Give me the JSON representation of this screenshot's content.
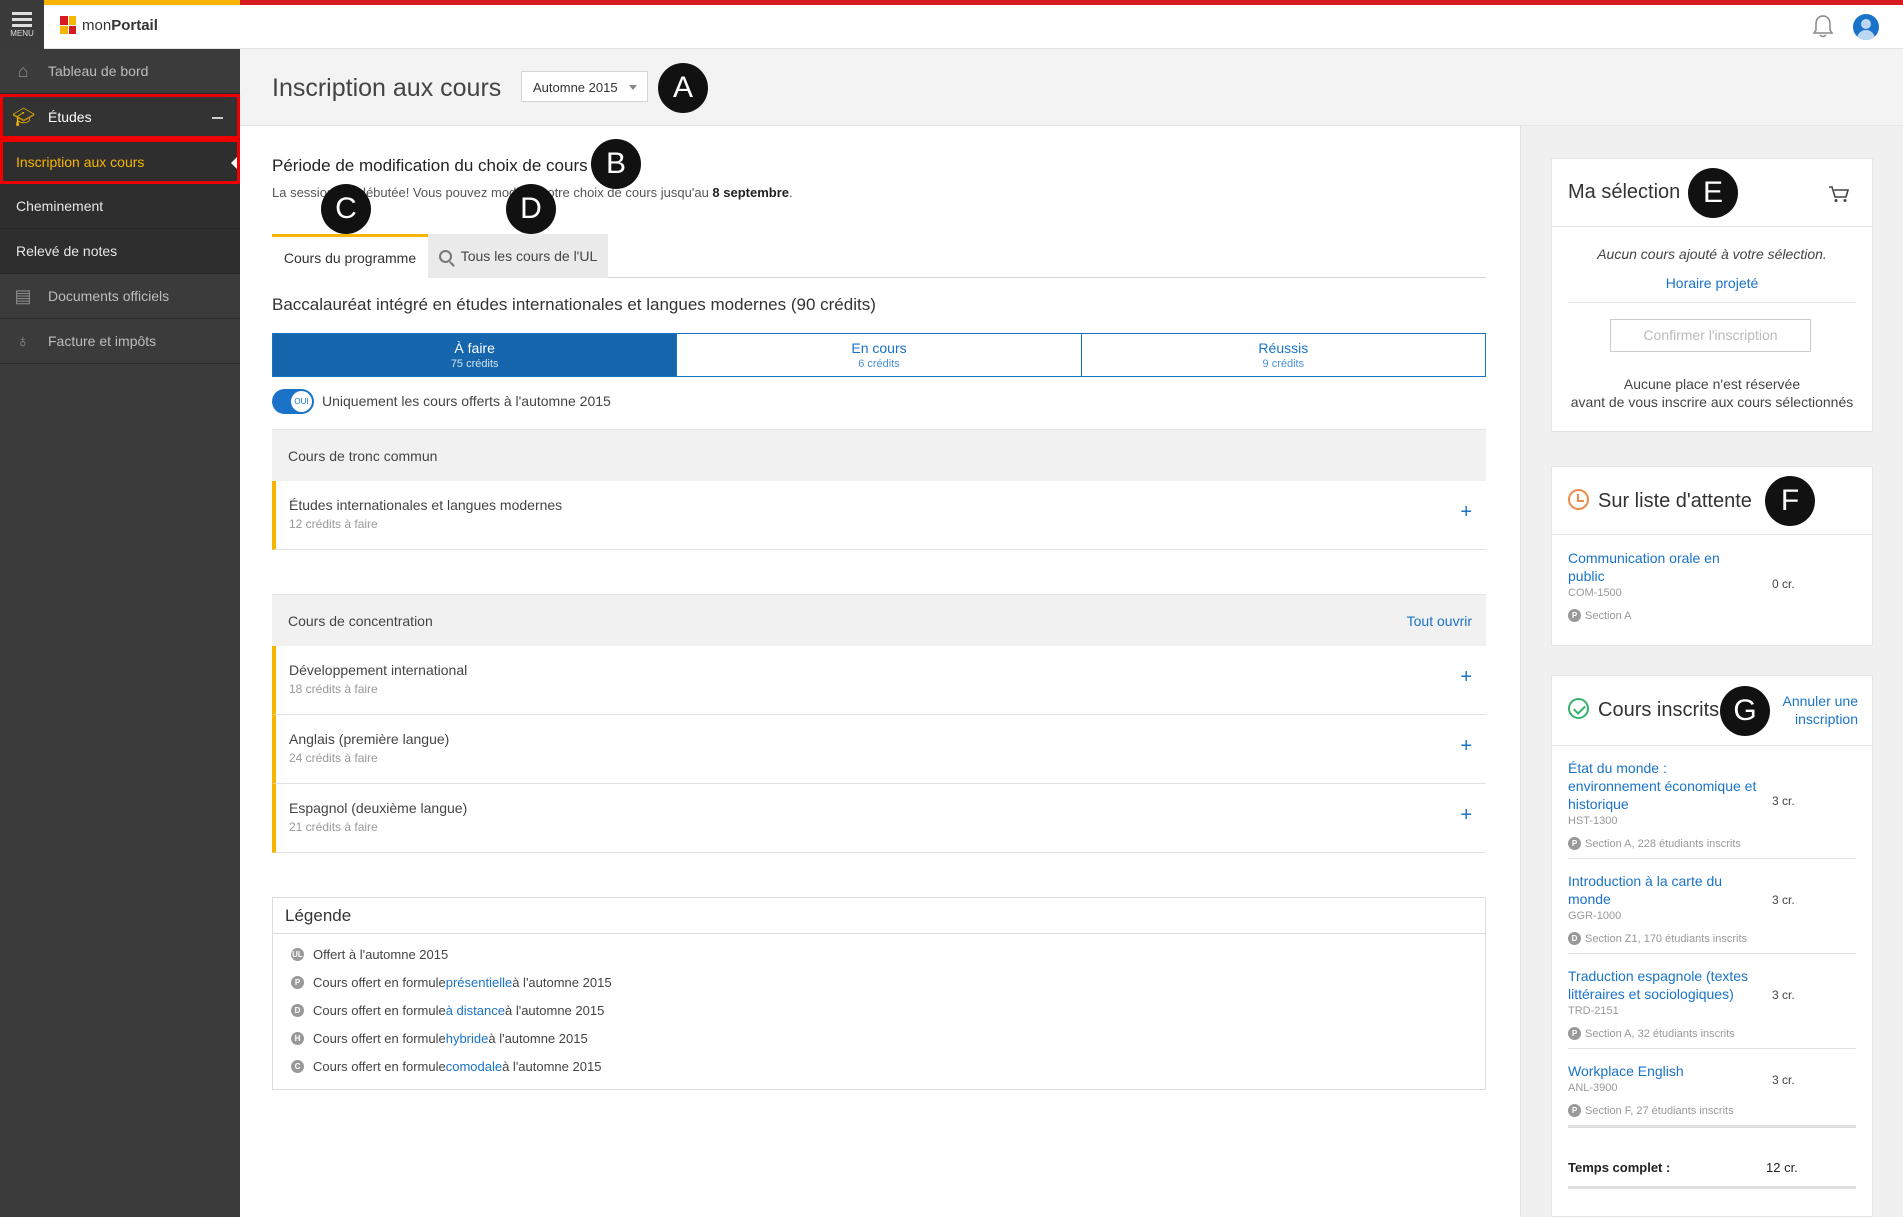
{
  "app": {
    "logo_prefix": "mon",
    "logo_bold": "Portail",
    "menu_label": "MENU"
  },
  "sidebar": {
    "items": [
      {
        "label": "Tableau de bord"
      },
      {
        "label": "Études"
      },
      {
        "label": "Documents officiels"
      },
      {
        "label": "Facture et impôts"
      }
    ],
    "subitems": [
      {
        "label": "Inscription aux cours"
      },
      {
        "label": "Cheminement"
      },
      {
        "label": "Relevé de notes"
      }
    ]
  },
  "header": {
    "title": "Inscription aux cours",
    "semester": "Automne 2015"
  },
  "markers": [
    "A",
    "B",
    "C",
    "D",
    "E",
    "F",
    "G"
  ],
  "period": {
    "title": "Période de modification du choix de cours",
    "text": "La session est débutée! Vous pouvez modifier votre choix de cours jusqu'au ",
    "date": "8 septembre",
    "dot": "."
  },
  "tabs": [
    {
      "label": "Cours du programme"
    },
    {
      "label": "Tous les cours de l'UL"
    }
  ],
  "program": {
    "title": "Baccalauréat intégré en études internationales et langues modernes (90 crédits)"
  },
  "segments": [
    {
      "label": "À faire",
      "credits": "75 crédits"
    },
    {
      "label": "En cours",
      "credits": "6 crédits"
    },
    {
      "label": "Réussis",
      "credits": "9 crédits"
    }
  ],
  "toggle": {
    "state": "OUI",
    "label": "Uniquement les cours offerts à l'automne 2015"
  },
  "groups": [
    {
      "title": "Cours de tronc commun",
      "courses": [
        {
          "name": "Études internationales et langues modernes",
          "credits": "12 crédits à faire"
        }
      ]
    },
    {
      "title": "Cours de concentration",
      "open_all": "Tout ouvrir",
      "courses": [
        {
          "name": "Développement international",
          "credits": "18 crédits à faire"
        },
        {
          "name": "Anglais (première langue)",
          "credits": "24 crédits à faire"
        },
        {
          "name": "Espagnol (deuxième langue)",
          "credits": "21 crédits à faire"
        }
      ]
    }
  ],
  "legend": {
    "title": "Légende",
    "items": [
      {
        "badge": "UL",
        "pre": "Offert à l'automne 2015",
        "link": "",
        "post": ""
      },
      {
        "badge": "P",
        "pre": "Cours offert en formule ",
        "link": "présentielle",
        "post": " à l'automne 2015"
      },
      {
        "badge": "D",
        "pre": "Cours offert en formule ",
        "link": "à distance",
        "post": " à l'automne 2015"
      },
      {
        "badge": "H",
        "pre": "Cours offert en formule ",
        "link": "hybride",
        "post": " à l'automne 2015"
      },
      {
        "badge": "C",
        "pre": "Cours offert en formule ",
        "link": "comodale",
        "post": " à l'automne 2015"
      }
    ]
  },
  "selection": {
    "title": "Ma sélection",
    "empty": "Aucun cours ajouté à votre sélection.",
    "schedule_link": "Horaire projeté",
    "confirm": "Confirmer l'inscription",
    "note1": "Aucune place n'est réservée",
    "note2": "avant de vous inscrire aux cours sélectionnés"
  },
  "waitlist": {
    "title": "Sur liste d'attente",
    "courses": [
      {
        "name": "Communication orale en public",
        "code": "COM-1500",
        "credits": "0 cr.",
        "badge": "P",
        "section": "Section A"
      }
    ]
  },
  "enrolled": {
    "title": "Cours inscrits",
    "cancel": "Annuler une inscription",
    "courses": [
      {
        "name": "État du monde : environnement économique et historique",
        "code": "HST-1300",
        "credits": "3 cr.",
        "badge": "P",
        "section": "Section A, 228 étudiants inscrits"
      },
      {
        "name": "Introduction à la carte du monde",
        "code": "GGR-1000",
        "credits": "3 cr.",
        "badge": "D",
        "section": "Section Z1, 170 étudiants inscrits"
      },
      {
        "name": "Traduction espagnole (textes littéraires et sociologiques)",
        "code": "TRD-2151",
        "credits": "3 cr.",
        "badge": "P",
        "section": "Section A, 32 étudiants inscrits"
      },
      {
        "name": "Workplace English",
        "code": "ANL-3900",
        "credits": "3 cr.",
        "badge": "P",
        "section": "Section F, 27 étudiants inscrits"
      }
    ],
    "total_label": "Temps complet :",
    "total_credits": "12 cr."
  },
  "colors": {
    "accent": "#1a73c8",
    "brand_red": "#d71920",
    "brand_yellow": "#f7b500",
    "sidebar": "#3b3b3b"
  }
}
